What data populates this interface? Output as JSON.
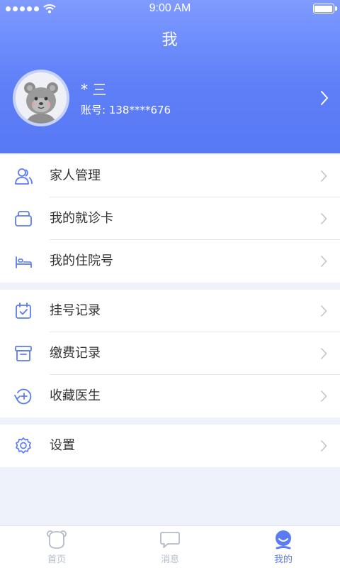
{
  "status_bar": {
    "time": "9:00 AM"
  },
  "header": {
    "title": "我"
  },
  "profile": {
    "name": "* 三",
    "account_label": "账号:",
    "account_value": "138****676"
  },
  "menu_groups": [
    [
      {
        "label": "家人管理",
        "icon": "family-icon"
      },
      {
        "label": "我的就诊卡",
        "icon": "card-icon"
      },
      {
        "label": "我的住院号",
        "icon": "bed-icon"
      }
    ],
    [
      {
        "label": "挂号记录",
        "icon": "calendar-check-icon"
      },
      {
        "label": "缴费记录",
        "icon": "archive-box-icon"
      },
      {
        "label": "收藏医生",
        "icon": "add-favorite-icon"
      }
    ],
    [
      {
        "label": "设置",
        "icon": "gear-icon"
      }
    ]
  ],
  "tabbar": {
    "tabs": [
      {
        "label": "首页",
        "icon": "home-bear-icon",
        "active": false
      },
      {
        "label": "消息",
        "icon": "message-bubble-icon",
        "active": false
      },
      {
        "label": "我的",
        "icon": "profile-smile-icon",
        "active": true
      }
    ]
  },
  "colors": {
    "primary": "#5a7bf5",
    "header_top": "#7f9bff",
    "header_bottom": "#5879f4",
    "page_bg": "#eef3fb",
    "tab_inactive": "#b4bccb"
  }
}
